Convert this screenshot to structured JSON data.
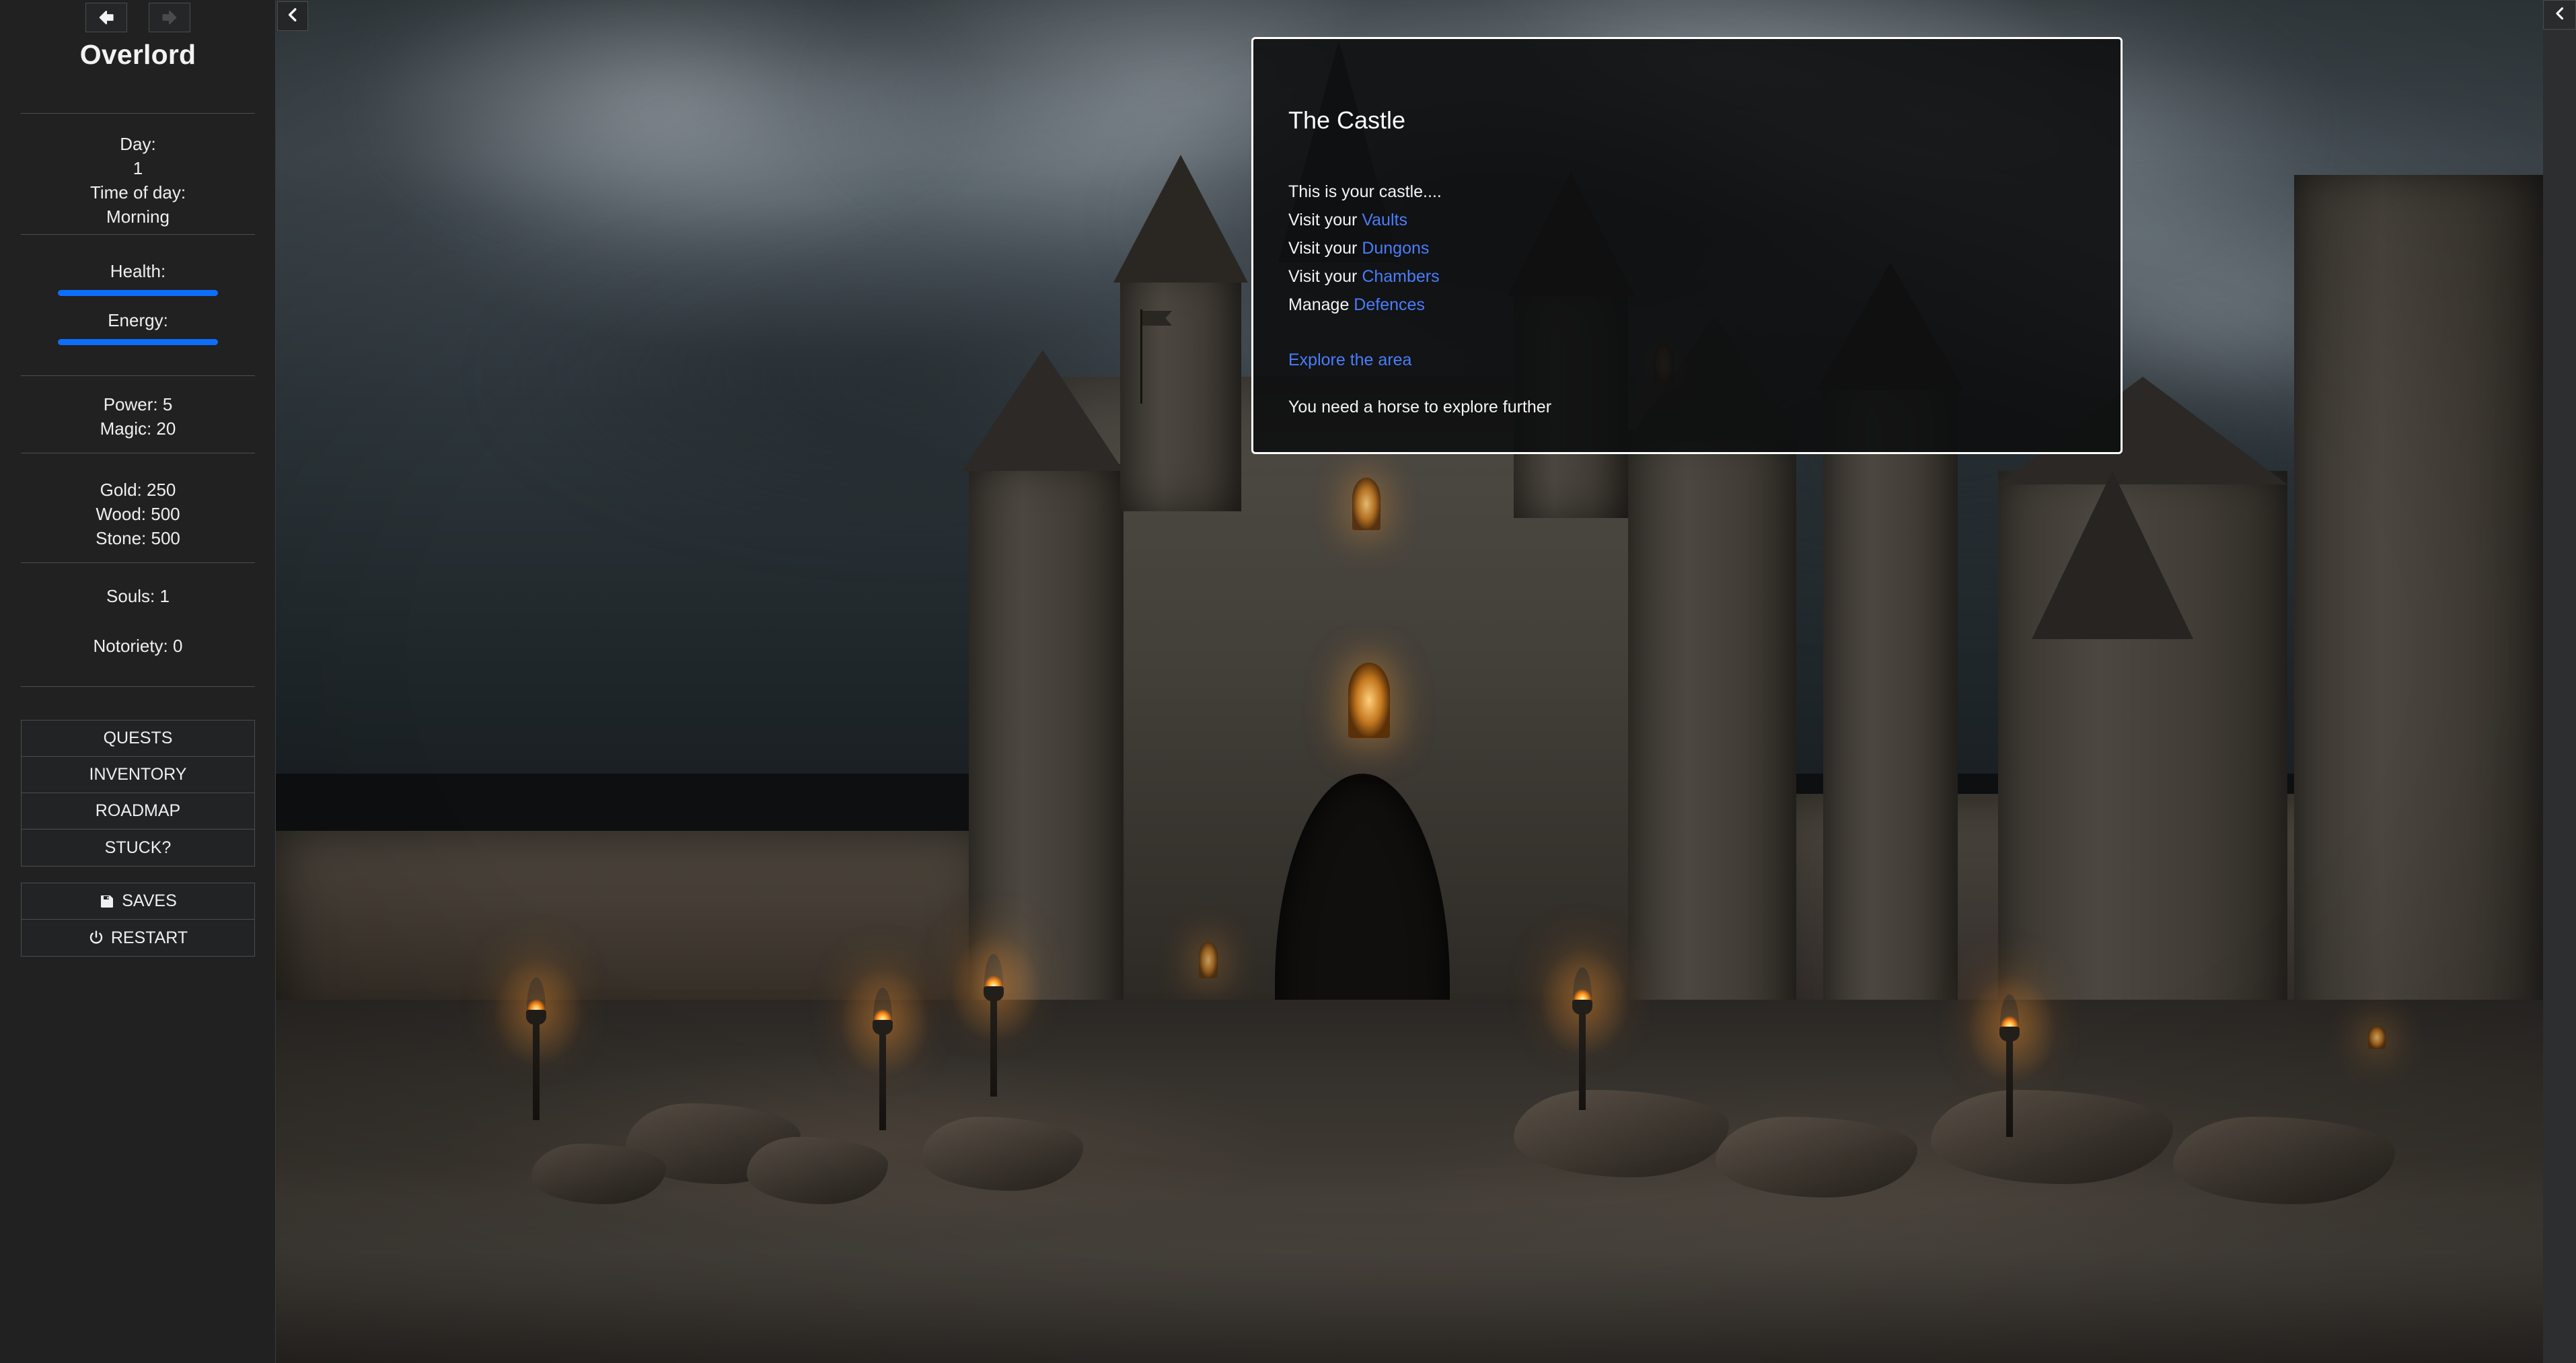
{
  "sidebar": {
    "nav": {
      "back_icon": "arrow-left-icon",
      "forward_icon": "arrow-right-icon",
      "collapse_icon": "chevron-left-icon"
    },
    "title": "Overlord",
    "time": {
      "day_label": "Day:",
      "day_value": "1",
      "tod_label": "Time of day:",
      "tod_value": "Morning"
    },
    "vitals": {
      "health_label": "Health:",
      "health_percent": 100,
      "energy_label": "Energy:",
      "energy_percent": 100,
      "bar_color": "#0d6efd"
    },
    "attributes": {
      "power": "Power: 5",
      "magic": "Magic: 20"
    },
    "resources": {
      "gold": "Gold: 250",
      "wood": "Wood: 500",
      "stone": "Stone: 500"
    },
    "souls": "Souls: 1",
    "notoriety": "Notoriety: 0",
    "menu": [
      {
        "label": "QUESTS",
        "icon": null
      },
      {
        "label": "INVENTORY",
        "icon": null
      },
      {
        "label": "ROADMAP",
        "icon": null
      },
      {
        "label": "STUCK?",
        "icon": null
      }
    ],
    "system": [
      {
        "label": "SAVES",
        "icon": "floppy-disk-icon"
      },
      {
        "label": "RESTART",
        "icon": "power-icon"
      }
    ]
  },
  "panel": {
    "title": "The Castle",
    "intro": "This is your castle....",
    "links": [
      {
        "prefix": "Visit your ",
        "link": "Vaults"
      },
      {
        "prefix": "Visit your ",
        "link": "Dungons"
      },
      {
        "prefix": "Visit your ",
        "link": "Chambers"
      },
      {
        "prefix": "Manage ",
        "link": "Defences"
      }
    ],
    "explore_link": "Explore the area",
    "note": "You need a horse to explore further",
    "link_color": "#4a7dfb",
    "border_color": "#ffffff"
  },
  "right_sidebar": {
    "collapse_icon": "chevron-left-icon"
  },
  "stage": {
    "collapse_icon": "chevron-left-icon"
  }
}
